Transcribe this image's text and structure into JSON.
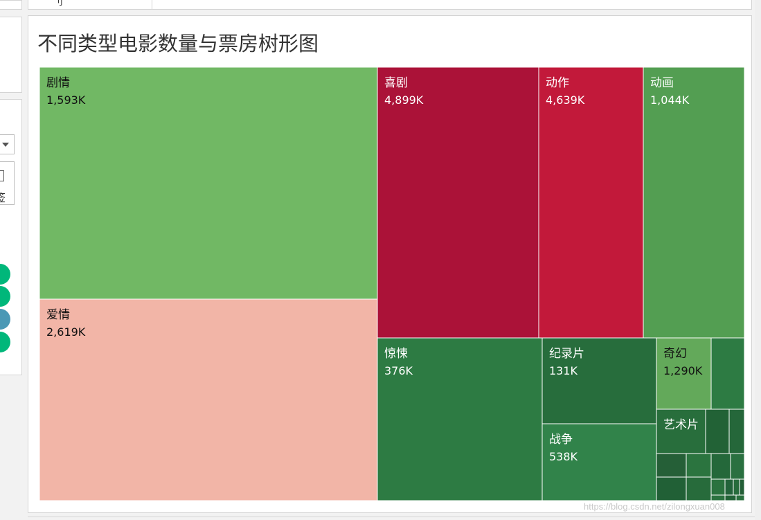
{
  "top_tab": {
    "glyph": "刂"
  },
  "left_panel": {
    "box_glyph": "签",
    "legend_dots": [
      "#00b77a",
      "#00b77a",
      "#4a98b5",
      "#00b77a"
    ]
  },
  "watermark": "https://blog.csdn.net/zilongxuan008",
  "chart_data": {
    "type": "treemap",
    "title": "不同类型电影数量与票房树形图",
    "size_measure": "电影数量",
    "color_measure": "票房",
    "series": [
      {
        "name": "剧情",
        "label": "1,593K",
        "color": "#71b864",
        "label_color": "#111111"
      },
      {
        "name": "爱情",
        "label": "2,619K",
        "color": "#f2b5a7",
        "label_color": "#111111"
      },
      {
        "name": "喜剧",
        "label": "4,899K",
        "color": "#ab1238",
        "label_color": "#ffffff"
      },
      {
        "name": "动作",
        "label": "4,639K",
        "color": "#c2193a",
        "label_color": "#ffffff"
      },
      {
        "name": "动画",
        "label": "1,044K",
        "color": "#539e52",
        "label_color": "#ffffff"
      },
      {
        "name": "惊悚",
        "label": "376K",
        "color": "#2d7b43",
        "label_color": "#ffffff"
      },
      {
        "name": "纪录片",
        "label": "131K",
        "color": "#276d3c",
        "label_color": "#ffffff"
      },
      {
        "name": "战争",
        "label": "538K",
        "color": "#31834a",
        "label_color": "#ffffff"
      },
      {
        "name": "奇幻",
        "label": "1,290K",
        "color": "#63a95a",
        "label_color": "#111111"
      },
      {
        "name": "艺术片",
        "label": "",
        "color": "#286e3c",
        "label_color": "#ffffff"
      },
      {
        "name": "",
        "label": "",
        "color": "#2d7b43"
      },
      {
        "name": "",
        "label": "",
        "color": "#226236"
      },
      {
        "name": "",
        "label": "",
        "color": "#25673a"
      },
      {
        "name": "",
        "label": "",
        "color": "#255f37"
      },
      {
        "name": "",
        "label": "",
        "color": "#2b743f"
      },
      {
        "name": "",
        "label": "",
        "color": "#24683a"
      },
      {
        "name": "",
        "label": "",
        "color": "#2a7040"
      },
      {
        "name": "",
        "label": "",
        "color": "#216036"
      },
      {
        "name": "",
        "label": "",
        "color": "#276b3b"
      },
      {
        "name": "",
        "label": "",
        "color": "#2a723e"
      },
      {
        "name": "",
        "label": "",
        "color": "#23633a"
      },
      {
        "name": "",
        "label": "",
        "color": "#276c3c"
      },
      {
        "name": "",
        "label": "",
        "color": "#245f37"
      },
      {
        "name": "",
        "label": "",
        "color": "#2b723f"
      },
      {
        "name": "",
        "label": "",
        "color": "#226236"
      },
      {
        "name": "",
        "label": "",
        "color": "#2a703e"
      }
    ]
  }
}
